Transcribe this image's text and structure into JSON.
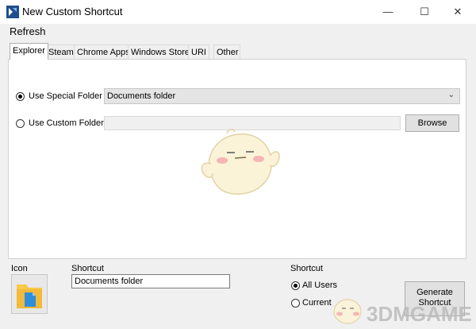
{
  "window": {
    "title": "New Custom Shortcut",
    "minimize": "—",
    "maximize": "☐",
    "close": "✕"
  },
  "menu": {
    "refresh": "Refresh"
  },
  "tabs": [
    {
      "label": "Explorer"
    },
    {
      "label": "Steam"
    },
    {
      "label": "Chrome Apps"
    },
    {
      "label": "Windows Store"
    },
    {
      "label": "URI"
    },
    {
      "label": "Other"
    }
  ],
  "explorer": {
    "special_folder_label": "Use Special Folder",
    "special_folder_value": "Documents folder",
    "custom_folder_label": "Use Custom Folder",
    "custom_folder_value": "",
    "browse_label": "Browse"
  },
  "bottom": {
    "icon_label": "Icon",
    "shortcut_name_label": "Shortcut",
    "shortcut_name_value": "Documents folder",
    "shortcut_scope_label": "Shortcut",
    "all_users_label": "All Users",
    "current_label": "Current",
    "generate_label_line1": "Generate",
    "generate_label_line2": "Shortcut"
  },
  "watermark": {
    "text": "3DMGAME"
  },
  "colors": {
    "folder": "#f7c948",
    "document": "#2f8fdc",
    "mascot": "#fbf3d8",
    "watermark": "#b9b9b9"
  }
}
